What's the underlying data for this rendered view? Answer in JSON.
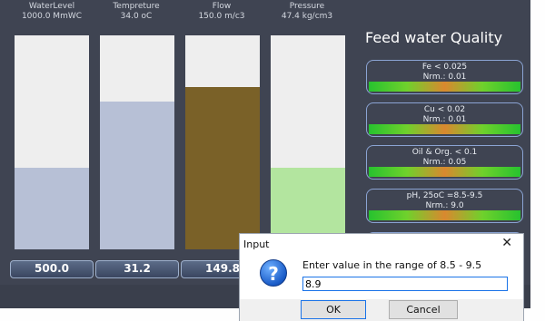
{
  "gauges": [
    {
      "name": "WaterLevel",
      "reading": "1000.0 MmWC",
      "value": "500.0",
      "fill_fraction": 0.38,
      "fill_color": "#b7c0d6"
    },
    {
      "name": "Tempreture",
      "reading": "34.0 oC",
      "value": "31.2",
      "fill_fraction": 0.69,
      "fill_color": "#b7c0d6"
    },
    {
      "name": "Flow",
      "reading": "150.0 m/c3",
      "value": "149.8",
      "fill_fraction": 0.76,
      "fill_color": "#7a6128"
    },
    {
      "name": "Pressure",
      "reading": "47.4 kg/cm3",
      "value": "",
      "fill_fraction": 0.38,
      "fill_color": "#b3e59f"
    }
  ],
  "quality": {
    "title": "Feed water Quality",
    "items": [
      {
        "limit": "Fe < 0.025",
        "normal": "Nrm.: 0.01"
      },
      {
        "limit": "Cu < 0.02",
        "normal": "Nrm.: 0.01"
      },
      {
        "limit": "Oil & Org. < 0.1",
        "normal": "Nrm.: 0.05"
      },
      {
        "limit": "pH, 25oC =8.5-9.5",
        "normal": "Nrm.: 9.0"
      }
    ]
  },
  "dialog": {
    "title": "Input",
    "close": "✕",
    "icon": "?",
    "prompt": "Enter value in the range of 8.5 - 9.5",
    "input_value": "8.9",
    "ok_label": "OK",
    "cancel_label": "Cancel"
  },
  "colors": {
    "panel_bg": "#3f4452",
    "bar_empty": "#eeeeee",
    "card_border": "#8ba4d4",
    "accent_blue": "#1a73e8"
  }
}
